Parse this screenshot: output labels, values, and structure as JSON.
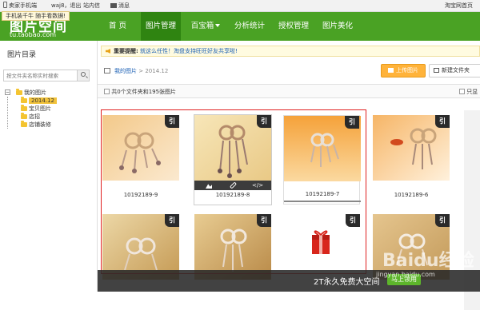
{
  "topbar": {
    "mobile_label": "卖家手机端",
    "user_text": "waj8，退出",
    "inbox_label": "站内信",
    "message_label": "消息",
    "right_link": "淘宝网首页",
    "tooltip": "手机装千牛 随手看数据!"
  },
  "header": {
    "logo_title": "图片空间",
    "logo_sub": "tu.taobao.com",
    "nav": [
      {
        "label": "首 页"
      },
      {
        "label": "图片管理"
      },
      {
        "label": "百宝箱"
      },
      {
        "label": "分析统计"
      },
      {
        "label": "授权管理"
      },
      {
        "label": "图片美化"
      }
    ]
  },
  "sidebar": {
    "title": "图片目录",
    "search_placeholder": "按文件夹名称实时搜索",
    "tree": {
      "root": "我的图片",
      "children": [
        "2014.12",
        "宝贝图片",
        "店招",
        "店铺装修"
      ]
    }
  },
  "notice": {
    "bold": "重要提醒:",
    "text": "就这么任性！淘盘支持旺旺好友共享啦!"
  },
  "breadcrumb": {
    "root": "我的图片",
    "separator": ">",
    "current": "2014.12"
  },
  "buttons": {
    "upload": "上传图片",
    "new_folder": "新建文件夹"
  },
  "toolbar": {
    "count_text": "共0个文件夹和195张图片",
    "right_text": "只显"
  },
  "tiles": [
    {
      "caption": "10192189-9",
      "badge": "引"
    },
    {
      "caption": "10192189-8",
      "badge": "引"
    },
    {
      "caption": "10192189-7",
      "badge": "引"
    },
    {
      "caption": "10192189-6",
      "badge": "引"
    },
    {
      "caption": "",
      "badge": "引"
    },
    {
      "caption": "",
      "badge": "引"
    },
    {
      "caption": "",
      "badge": "引"
    },
    {
      "caption": "",
      "badge": "引"
    }
  ],
  "banner": {
    "text": "2T永久免费大空间",
    "cta": "马上领用"
  },
  "watermark": {
    "brand": "Baidu经验",
    "sub": "jingyan.baidu.com"
  },
  "colors": {
    "header_green": "#4aa224",
    "nav_active": "#2f8411",
    "upload_orange": "#ffb33a",
    "selection_red": "#e02020",
    "folder_yellow": "#f4c431"
  }
}
